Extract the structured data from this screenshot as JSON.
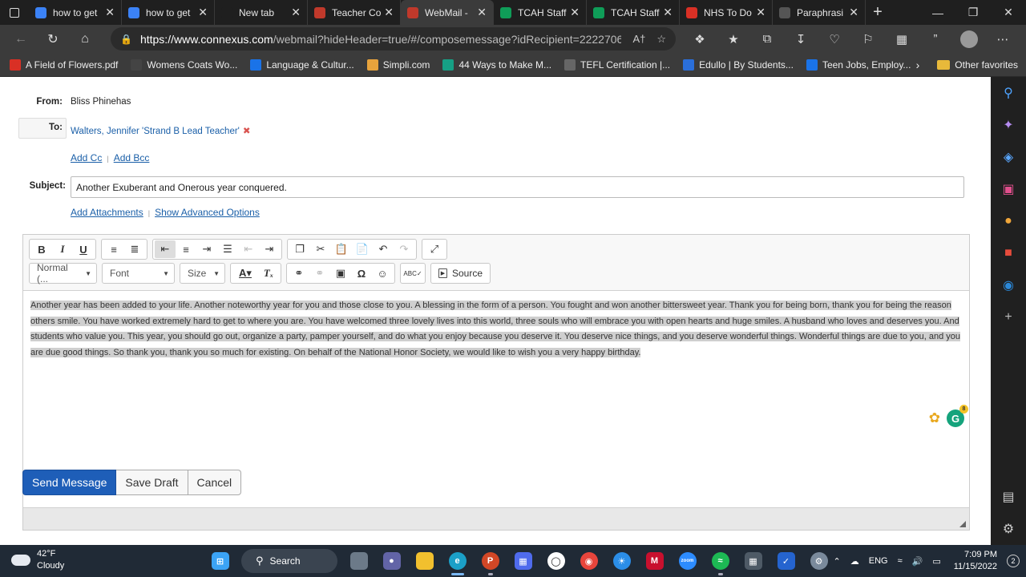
{
  "browser": {
    "tabs": [
      {
        "title": "how to get",
        "favicon": "search-icon",
        "color": "#3b82f6"
      },
      {
        "title": "how to get",
        "favicon": "search-icon",
        "color": "#3b82f6"
      },
      {
        "title": "New tab",
        "favicon": "",
        "color": "#1f1f1f"
      },
      {
        "title": "Teacher Co",
        "favicon": "connexus-icon",
        "color": "#c0392b"
      },
      {
        "title": "WebMail -",
        "favicon": "connexus-icon",
        "color": "#c0392b"
      },
      {
        "title": "TCAH Staff",
        "favicon": "sheets-icon",
        "color": "#0f9d58"
      },
      {
        "title": "TCAH Staff",
        "favicon": "sheets-icon",
        "color": "#0f9d58"
      },
      {
        "title": "NHS To Do",
        "favicon": "pdf-icon",
        "color": "#d93025"
      },
      {
        "title": "Paraphrasi",
        "favicon": "quill-icon",
        "color": "#555555"
      }
    ],
    "active_tab": 4,
    "url_host": "https://www.connexus.com",
    "url_path": "/webmail?hideHeader=true/#/composemessage?idRecipient=2222706&t...",
    "bookmarks": [
      {
        "label": "A Field of Flowers.pdf",
        "icon": "pdf-icon",
        "color": "#d93025"
      },
      {
        "label": "Womens Coats Wo...",
        "icon": "store-icon",
        "color": "#444444"
      },
      {
        "label": "Language & Cultur...",
        "icon": "b-icon",
        "color": "#1a73e8"
      },
      {
        "label": "Simpli.com",
        "icon": "gear-icon",
        "color": "#e8a33c"
      },
      {
        "label": "44 Ways to Make M...",
        "icon": "drop-icon",
        "color": "#16a085"
      },
      {
        "label": "TEFL Certification |...",
        "icon": "tefl-icon",
        "color": "#666666"
      },
      {
        "label": "Edullo | By Students...",
        "icon": "edullo-icon",
        "color": "#2a6fdb"
      },
      {
        "label": "Teen Jobs, Employ...",
        "icon": "person-icon",
        "color": "#1a73e8"
      }
    ],
    "other_favorites": "Other favorites"
  },
  "compose": {
    "from_label": "From:",
    "from_value": "Bliss Phinehas",
    "to_label": "To:",
    "to_value": "Walters, Jennifer 'Strand B Lead Teacher'",
    "add_cc": "Add Cc",
    "add_bcc": "Add Bcc",
    "subject_label": "Subject:",
    "subject_value": "Another Exuberant and Onerous year conquered.",
    "add_attachments": "Add Attachments",
    "show_advanced": "Show Advanced Options",
    "toolbar": {
      "format_combo": "Normal (...",
      "font_combo": "Font",
      "size_combo": "Size",
      "source_label": "Source"
    },
    "body_text": "Another year has been added to your life. Another noteworthy year for you and those close to you. A blessing in the form of a person. You fought and won another bittersweet year. Thank you for being born, thank you for being the reason others smile. You have worked extremely hard to get to where you are. You have welcomed three lovely lives into this world, three souls who will embrace you with open hearts and huge smiles. A husband who loves and deserves you. And students who value you. This year, you should go out, organize a party, pamper yourself, and do what you enjoy because you deserve it. You deserve nice things, and you deserve wonderful things. Wonderful things are due to you, and you are due good things. So thank you, thank you so much for existing. On behalf of the National Honor Society, we would like to wish you a very happy birthday.",
    "grammarly_count": "8",
    "buttons": {
      "send": "Send Message",
      "save_draft": "Save Draft",
      "cancel": "Cancel"
    }
  },
  "taskbar": {
    "weather_temp": "42°F",
    "weather_desc": "Cloudy",
    "search_label": "Search",
    "lang": "ENG",
    "time": "7:09 PM",
    "date": "11/15/2022",
    "notif_count": "2"
  }
}
